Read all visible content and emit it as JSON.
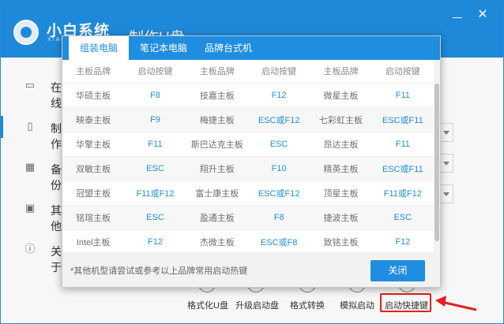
{
  "app": {
    "title": "小白系统",
    "subtitle": "XIAOBAI",
    "heading": "制作U盘",
    "close_glyph": "✕"
  },
  "sidebar": {
    "items": [
      {
        "label": "在线",
        "icon": "monitor-icon"
      },
      {
        "label": "制作",
        "icon": "usb-icon"
      },
      {
        "label": "备份",
        "icon": "grid-icon"
      },
      {
        "label": "其他",
        "icon": "box-icon"
      },
      {
        "label": "关于",
        "icon": "info-icon"
      }
    ]
  },
  "toolbar": {
    "buttons": [
      {
        "label": "格式化U盘",
        "icon": "check-icon"
      },
      {
        "label": "升级启动盘",
        "icon": "upload-icon"
      },
      {
        "label": "格式转换",
        "icon": "convert-icon"
      },
      {
        "label": "模拟启动",
        "icon": "simulate-icon"
      },
      {
        "label": "启动快捷键",
        "icon": "shield-icon"
      }
    ]
  },
  "modal": {
    "tabs": [
      "组装电脑",
      "笔记本电脑",
      "品牌台式机"
    ],
    "active_tab": 0,
    "headers": [
      "主板品牌",
      "启动按键",
      "主板品牌",
      "启动按键",
      "主板品牌",
      "启动按键"
    ],
    "rows": [
      [
        "华硕主板",
        "F8",
        "技嘉主板",
        "F12",
        "微星主板",
        "F11"
      ],
      [
        "映泰主板",
        "F9",
        "梅捷主板",
        "ESC或F12",
        "七彩虹主板",
        "ESC或F11"
      ],
      [
        "华擎主板",
        "F11",
        "斯巴达克主板",
        "ESC",
        "昂达主板",
        "F11"
      ],
      [
        "双敏主板",
        "ESC",
        "翔升主板",
        "F10",
        "精英主板",
        "ESC或F11"
      ],
      [
        "冠盟主板",
        "F11或F12",
        "富士康主板",
        "ESC或F12",
        "顶星主板",
        "F11或F12"
      ],
      [
        "铭瑄主板",
        "ESC",
        "盈通主板",
        "F8",
        "捷波主板",
        "ESC"
      ],
      [
        "Intel主板",
        "F12",
        "杰微主板",
        "ESC或F8",
        "致铭主板",
        "F12"
      ]
    ],
    "note": "*其他机型请尝试或参考以上品牌常用启动热键",
    "close_label": "关闭"
  },
  "colors": {
    "accent": "#1f8ee0",
    "highlight": "#e8231f"
  }
}
